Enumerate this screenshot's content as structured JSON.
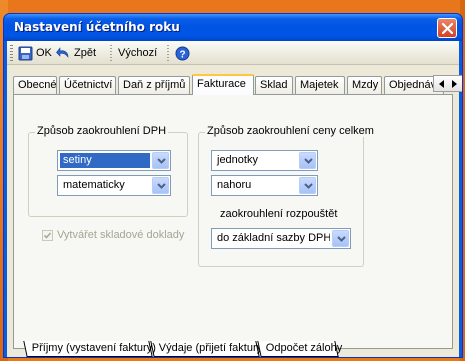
{
  "window": {
    "title": "Nastavení účetního roku"
  },
  "toolbar": {
    "ok_label": "OK",
    "back_label": "Zpět",
    "default_label": "Výchozí"
  },
  "tabs": [
    {
      "label": "Obecné"
    },
    {
      "label": "Účetnictví"
    },
    {
      "label": "Daň z příjmů"
    },
    {
      "label": "Fakturace",
      "active": true
    },
    {
      "label": "Sklad"
    },
    {
      "label": "Majetek"
    },
    {
      "label": "Mzdy"
    },
    {
      "label": "Objednávky"
    }
  ],
  "fakturace": {
    "vat_rounding": {
      "legend": "Způsob zaokrouhlení DPH",
      "precision_value": "setiny",
      "method_value": "matematicky"
    },
    "total_rounding": {
      "legend": "Způsob zaokrouhlení ceny celkem",
      "unit_value": "jednotky",
      "direction_value": "nahoru",
      "spread_label": "zaokrouhlení rozpouštět",
      "spread_value": "do základní sazby DPH"
    },
    "stock_docs": {
      "label": "Vytvářet skladové doklady",
      "checked": true,
      "enabled": false
    }
  },
  "bottom_tabs": [
    {
      "label": "Příjmy (vystavení faktury)",
      "active": true
    },
    {
      "label": "Výdaje (přijetí faktury)"
    },
    {
      "label": "Odpočet zálohy"
    }
  ],
  "colors": {
    "titlebar": "#0054e3",
    "desktop": "#e97a13",
    "selection": "#316ac5",
    "active_tab_accent": "#ffc83c"
  }
}
